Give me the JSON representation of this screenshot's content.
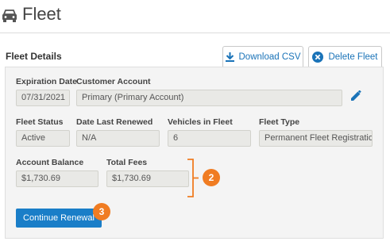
{
  "header": {
    "title": "Fleet",
    "icon": "car-icon"
  },
  "details": {
    "section_title": "Fleet Details",
    "download_label": "Download CSV",
    "delete_label": "Delete Fleet"
  },
  "fields": {
    "expiration_date": {
      "label": "Expiration Date",
      "value": "07/31/2021"
    },
    "customer_account": {
      "label": "Customer Account",
      "value": "Primary (Primary Account)"
    },
    "fleet_status": {
      "label": "Fleet Status",
      "value": "Active"
    },
    "date_last_renewed": {
      "label": "Date Last Renewed",
      "value": "N/A"
    },
    "vehicles_in_fleet": {
      "label": "Vehicles in Fleet",
      "value": "6"
    },
    "fleet_type": {
      "label": "Fleet Type",
      "value": "Permanent Fleet Registration"
    },
    "account_balance": {
      "label": "Account Balance",
      "value": "$1,730.69"
    },
    "total_fees": {
      "label": "Total Fees",
      "value": "$1,730.69"
    }
  },
  "annotations": {
    "badge_fees": "2",
    "badge_continue": "3"
  },
  "actions": {
    "continue_label": "Continue Renewal"
  },
  "colors": {
    "accent": "#1a7ec8",
    "badge": "#f07c22",
    "delete_icon": "#1a73b8"
  }
}
